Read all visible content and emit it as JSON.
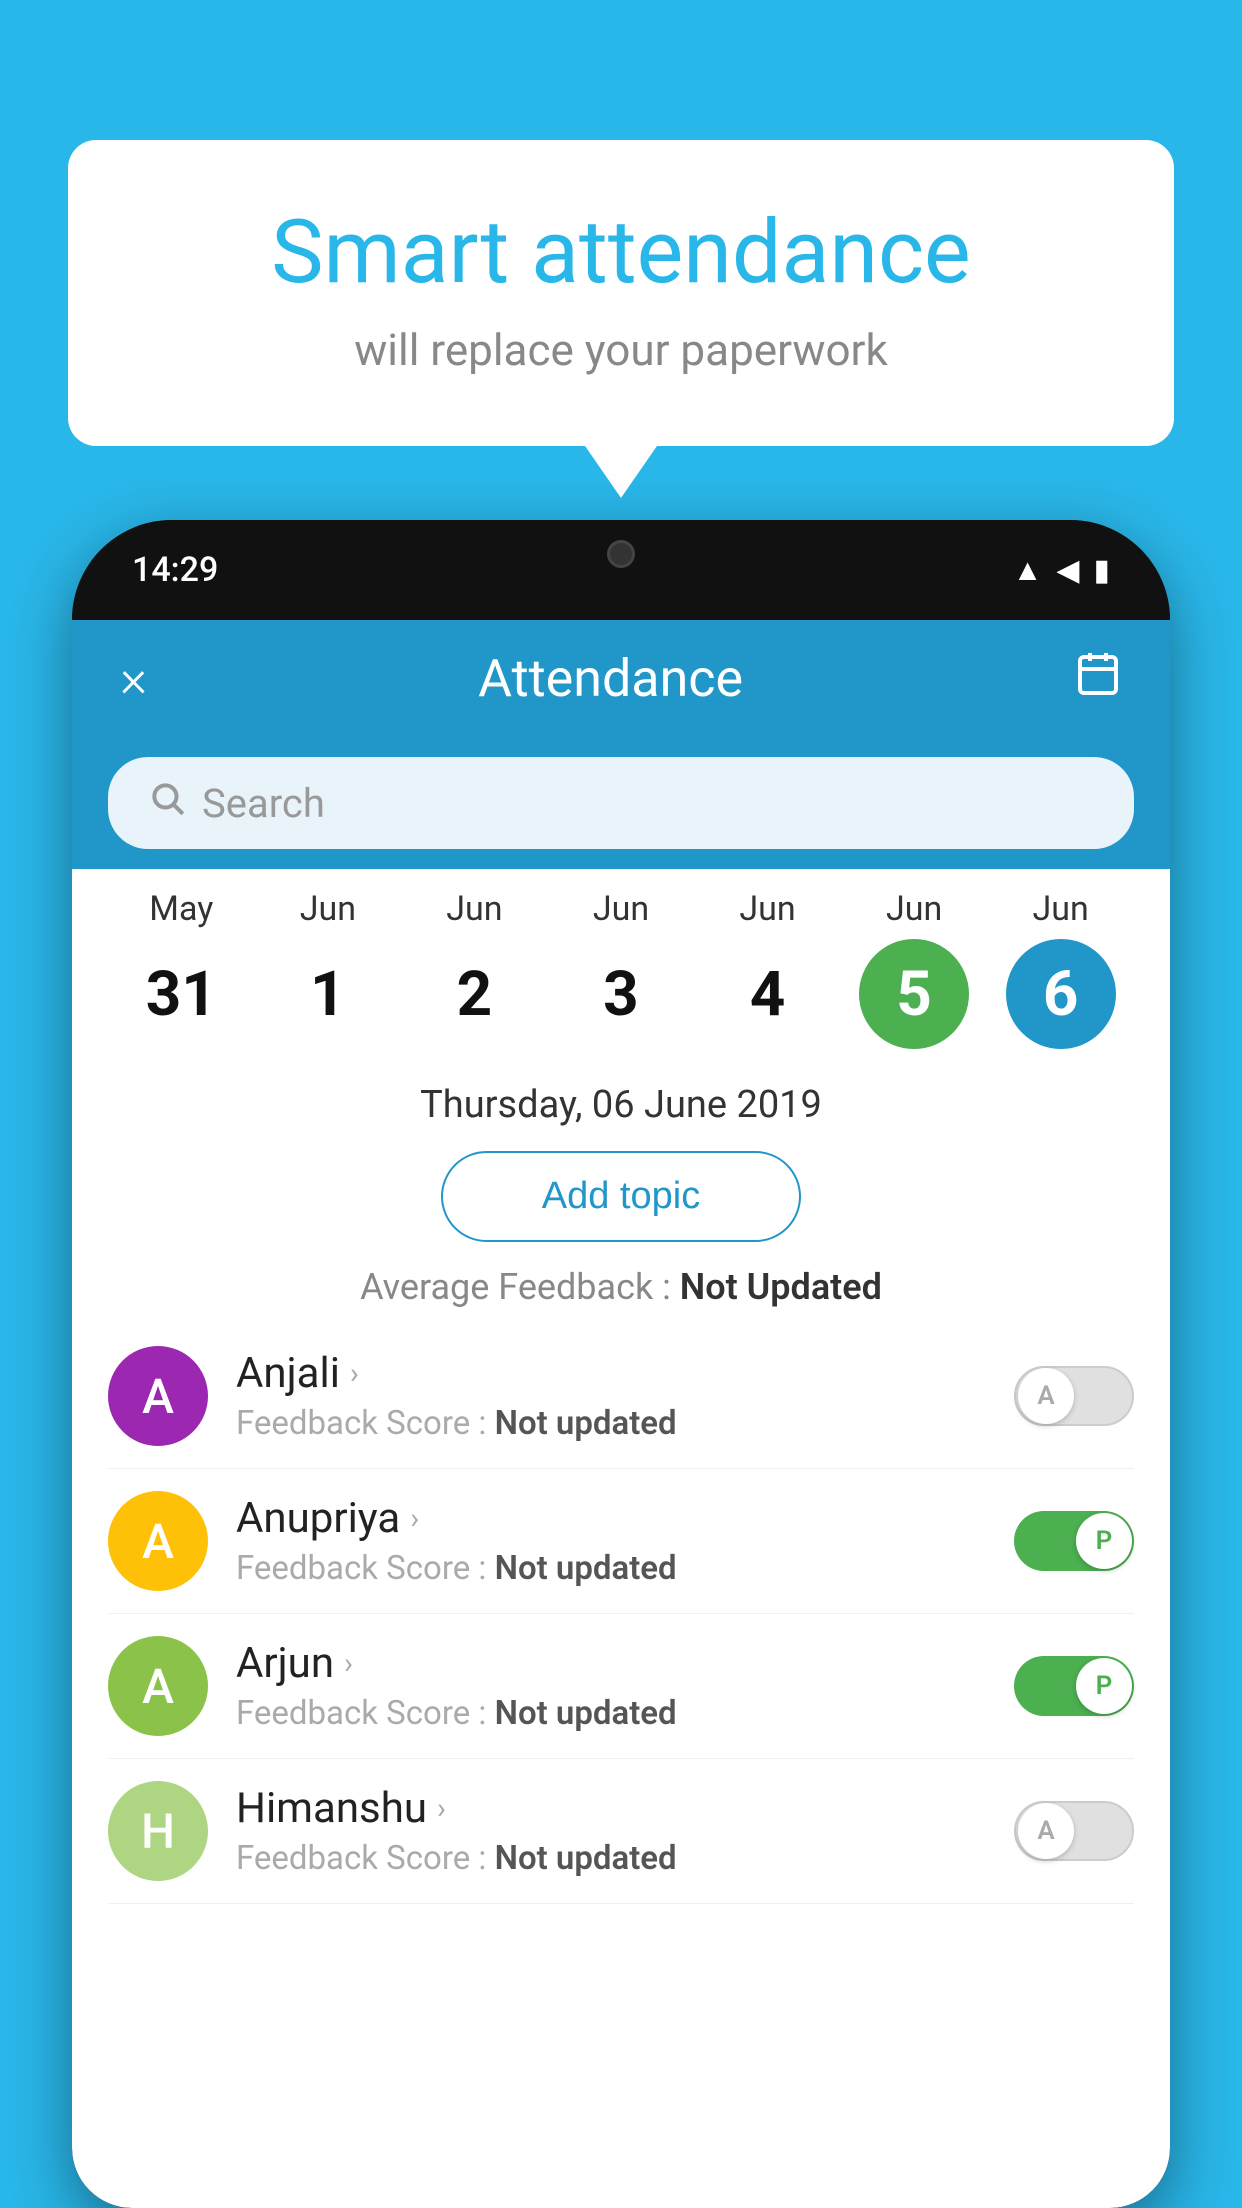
{
  "background_color": "#29b6e8",
  "speech_bubble": {
    "title": "Smart attendance",
    "subtitle": "will replace your paperwork"
  },
  "status_bar": {
    "time": "14:29",
    "icons": [
      "wifi",
      "signal",
      "battery"
    ]
  },
  "header": {
    "title": "Attendance",
    "close_label": "×",
    "calendar_label": "📅"
  },
  "search": {
    "placeholder": "Search"
  },
  "calendar": {
    "days": [
      {
        "month": "May",
        "date": "31",
        "state": "normal"
      },
      {
        "month": "Jun",
        "date": "1",
        "state": "normal"
      },
      {
        "month": "Jun",
        "date": "2",
        "state": "normal"
      },
      {
        "month": "Jun",
        "date": "3",
        "state": "normal"
      },
      {
        "month": "Jun",
        "date": "4",
        "state": "normal"
      },
      {
        "month": "Jun",
        "date": "5",
        "state": "today"
      },
      {
        "month": "Jun",
        "date": "6",
        "state": "selected"
      }
    ]
  },
  "selected_date": "Thursday, 06 June 2019",
  "add_topic_label": "Add topic",
  "avg_feedback_label": "Average Feedback :",
  "avg_feedback_value": "Not Updated",
  "students": [
    {
      "name": "Anjali",
      "avatar_letter": "A",
      "avatar_color": "#9c27b0",
      "feedback_label": "Feedback Score :",
      "feedback_value": "Not updated",
      "toggle_state": "off",
      "toggle_letter": "A"
    },
    {
      "name": "Anupriya",
      "avatar_letter": "A",
      "avatar_color": "#ffc107",
      "feedback_label": "Feedback Score :",
      "feedback_value": "Not updated",
      "toggle_state": "on",
      "toggle_letter": "P"
    },
    {
      "name": "Arjun",
      "avatar_letter": "A",
      "avatar_color": "#8bc34a",
      "feedback_label": "Feedback Score :",
      "feedback_value": "Not updated",
      "toggle_state": "on",
      "toggle_letter": "P"
    },
    {
      "name": "Himanshu",
      "avatar_letter": "H",
      "avatar_color": "#aed581",
      "feedback_label": "Feedback Score :",
      "feedback_value": "Not updated",
      "toggle_state": "off",
      "toggle_letter": "A"
    }
  ]
}
